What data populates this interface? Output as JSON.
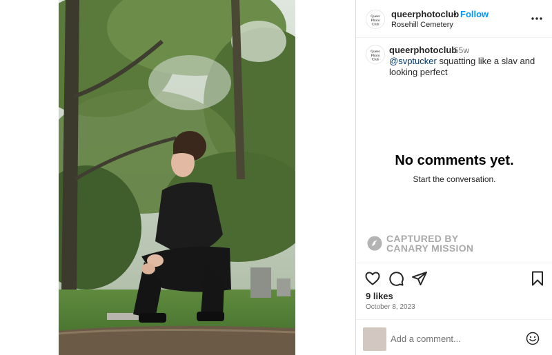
{
  "post": {
    "username": "queerphotoclub",
    "dot": "•",
    "follow_label": "Follow",
    "location": "Rosehill Cemetery",
    "caption_time": "55w",
    "mention": "@svptucker",
    "caption_text": " squatting like a slav and looking perfect",
    "empty_title": "No comments yet.",
    "empty_sub": "Start the conversation.",
    "likes": "9 likes",
    "date": "October 8, 2023",
    "comment_placeholder": "Add a comment..."
  },
  "watermark": {
    "line1": "CAPTURED BY",
    "line2": "CANARY MISSION"
  },
  "icons": {
    "more": "more-options-icon",
    "like": "heart-icon",
    "comment": "comment-icon",
    "share": "share-icon",
    "save": "bookmark-icon",
    "emoji": "emoji-icon"
  },
  "colors": {
    "link": "#0095f6",
    "mention": "#00376b",
    "muted": "#737373"
  }
}
